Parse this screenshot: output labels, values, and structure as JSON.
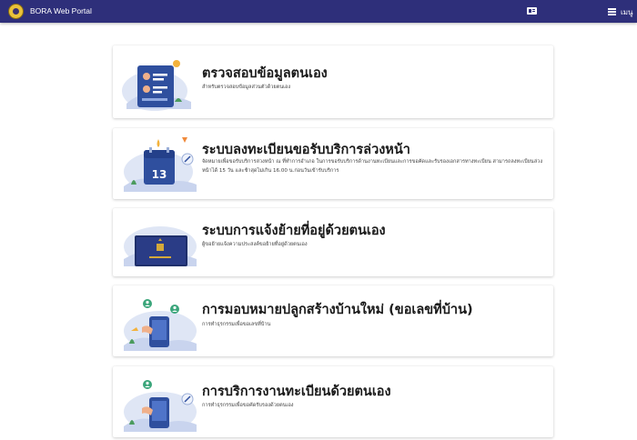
{
  "header": {
    "app_title": "BORA Web Portal",
    "menu_label": "เมนู",
    "icons": [
      "emblem-logo",
      "id-card-icon",
      "hamburger-menu-icon"
    ]
  },
  "cards": [
    {
      "title": "ตรวจสอบข้อมูลตนเอง",
      "description": "สำหรับตรวจสอบข้อมูลส่วนตัวด้วยตนเอง",
      "icon": "profile-document-icon"
    },
    {
      "title": "ระบบลงทะเบียนขอรับบริการล่วงหน้า",
      "description": "จัดหมายเพื่อขอรับบริการล่วงหน้า ณ ที่ทำการอำเภอ ในการขอรับบริการด้านงานทะเบียนและการขอคัดและรับรองเอกสารทางทะเบียน สามารถลงทะเบียนล่วงหน้าได้ 15 วัน และช้าสุดไม่เกิน 16.00 น.ก่อนวันเข้ารับบริการ",
      "icon": "calendar-icon",
      "calendar_day": "13"
    },
    {
      "title": "ระบบการแจ้งย้ายที่อยู่ด้วยตนเอง",
      "description": "ผู้ขอย้ายแจ้งความประสงค์ขอย้ายที่อยู่ด้วยตนเอง",
      "icon": "house-registration-book-icon"
    },
    {
      "title": "การมอบหมายปลูกสร้างบ้านใหม่ (ขอเลขที่บ้าน)",
      "description": "การทำธุรกรรมเพื่อขอเลขที่บ้าน",
      "icon": "mobile-transaction-icon"
    },
    {
      "title": "การบริการงานทะเบียนด้วยตนเอง",
      "description": "การทำธุรกรรมเพื่อขอคัดรับรองด้วยตนเอง",
      "icon": "mobile-transaction-icon"
    }
  ]
}
